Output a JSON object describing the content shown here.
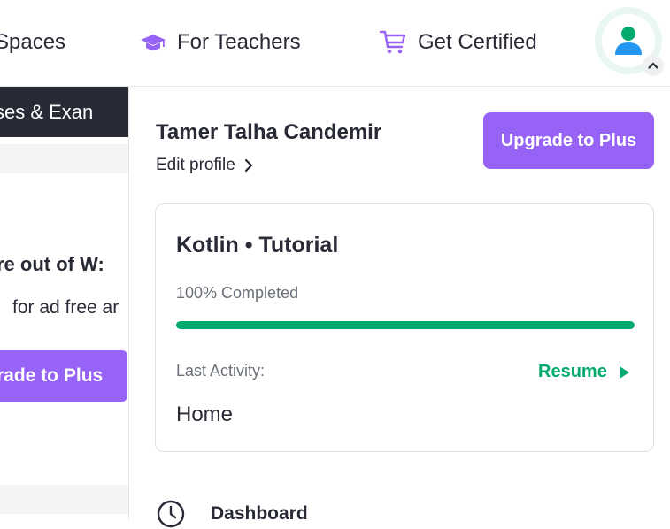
{
  "topnav": {
    "items": [
      {
        "label": "Spaces",
        "icon": "spaces-icon"
      },
      {
        "label": "For Teachers",
        "icon": "graduation-cap-icon"
      },
      {
        "label": "Get Certified",
        "icon": "cart-icon"
      }
    ],
    "avatar_icon": "user-icon"
  },
  "background_page": {
    "dark_bar_text": "ses & Exan",
    "heading": "re out of W:",
    "text": " for ad free ar",
    "button": "rade to Plus"
  },
  "panel": {
    "user_name": "Tamer Talha Candemir",
    "edit_profile": "Edit profile",
    "upgrade_button": "Upgrade to Plus",
    "course": {
      "title": "Kotlin • Tutorial",
      "progress_label": "100% Completed",
      "progress_percent": 100,
      "last_activity_label": "Last Activity:",
      "resume_label": "Resume",
      "last_activity_value": "Home"
    },
    "menu": [
      {
        "label": "Dashboard",
        "icon": "clock-icon"
      }
    ]
  },
  "colors": {
    "accent_purple": "#9763f6",
    "success_green": "#04aa6d",
    "avatar_blue": "#2196f3",
    "dark": "#282a35"
  }
}
